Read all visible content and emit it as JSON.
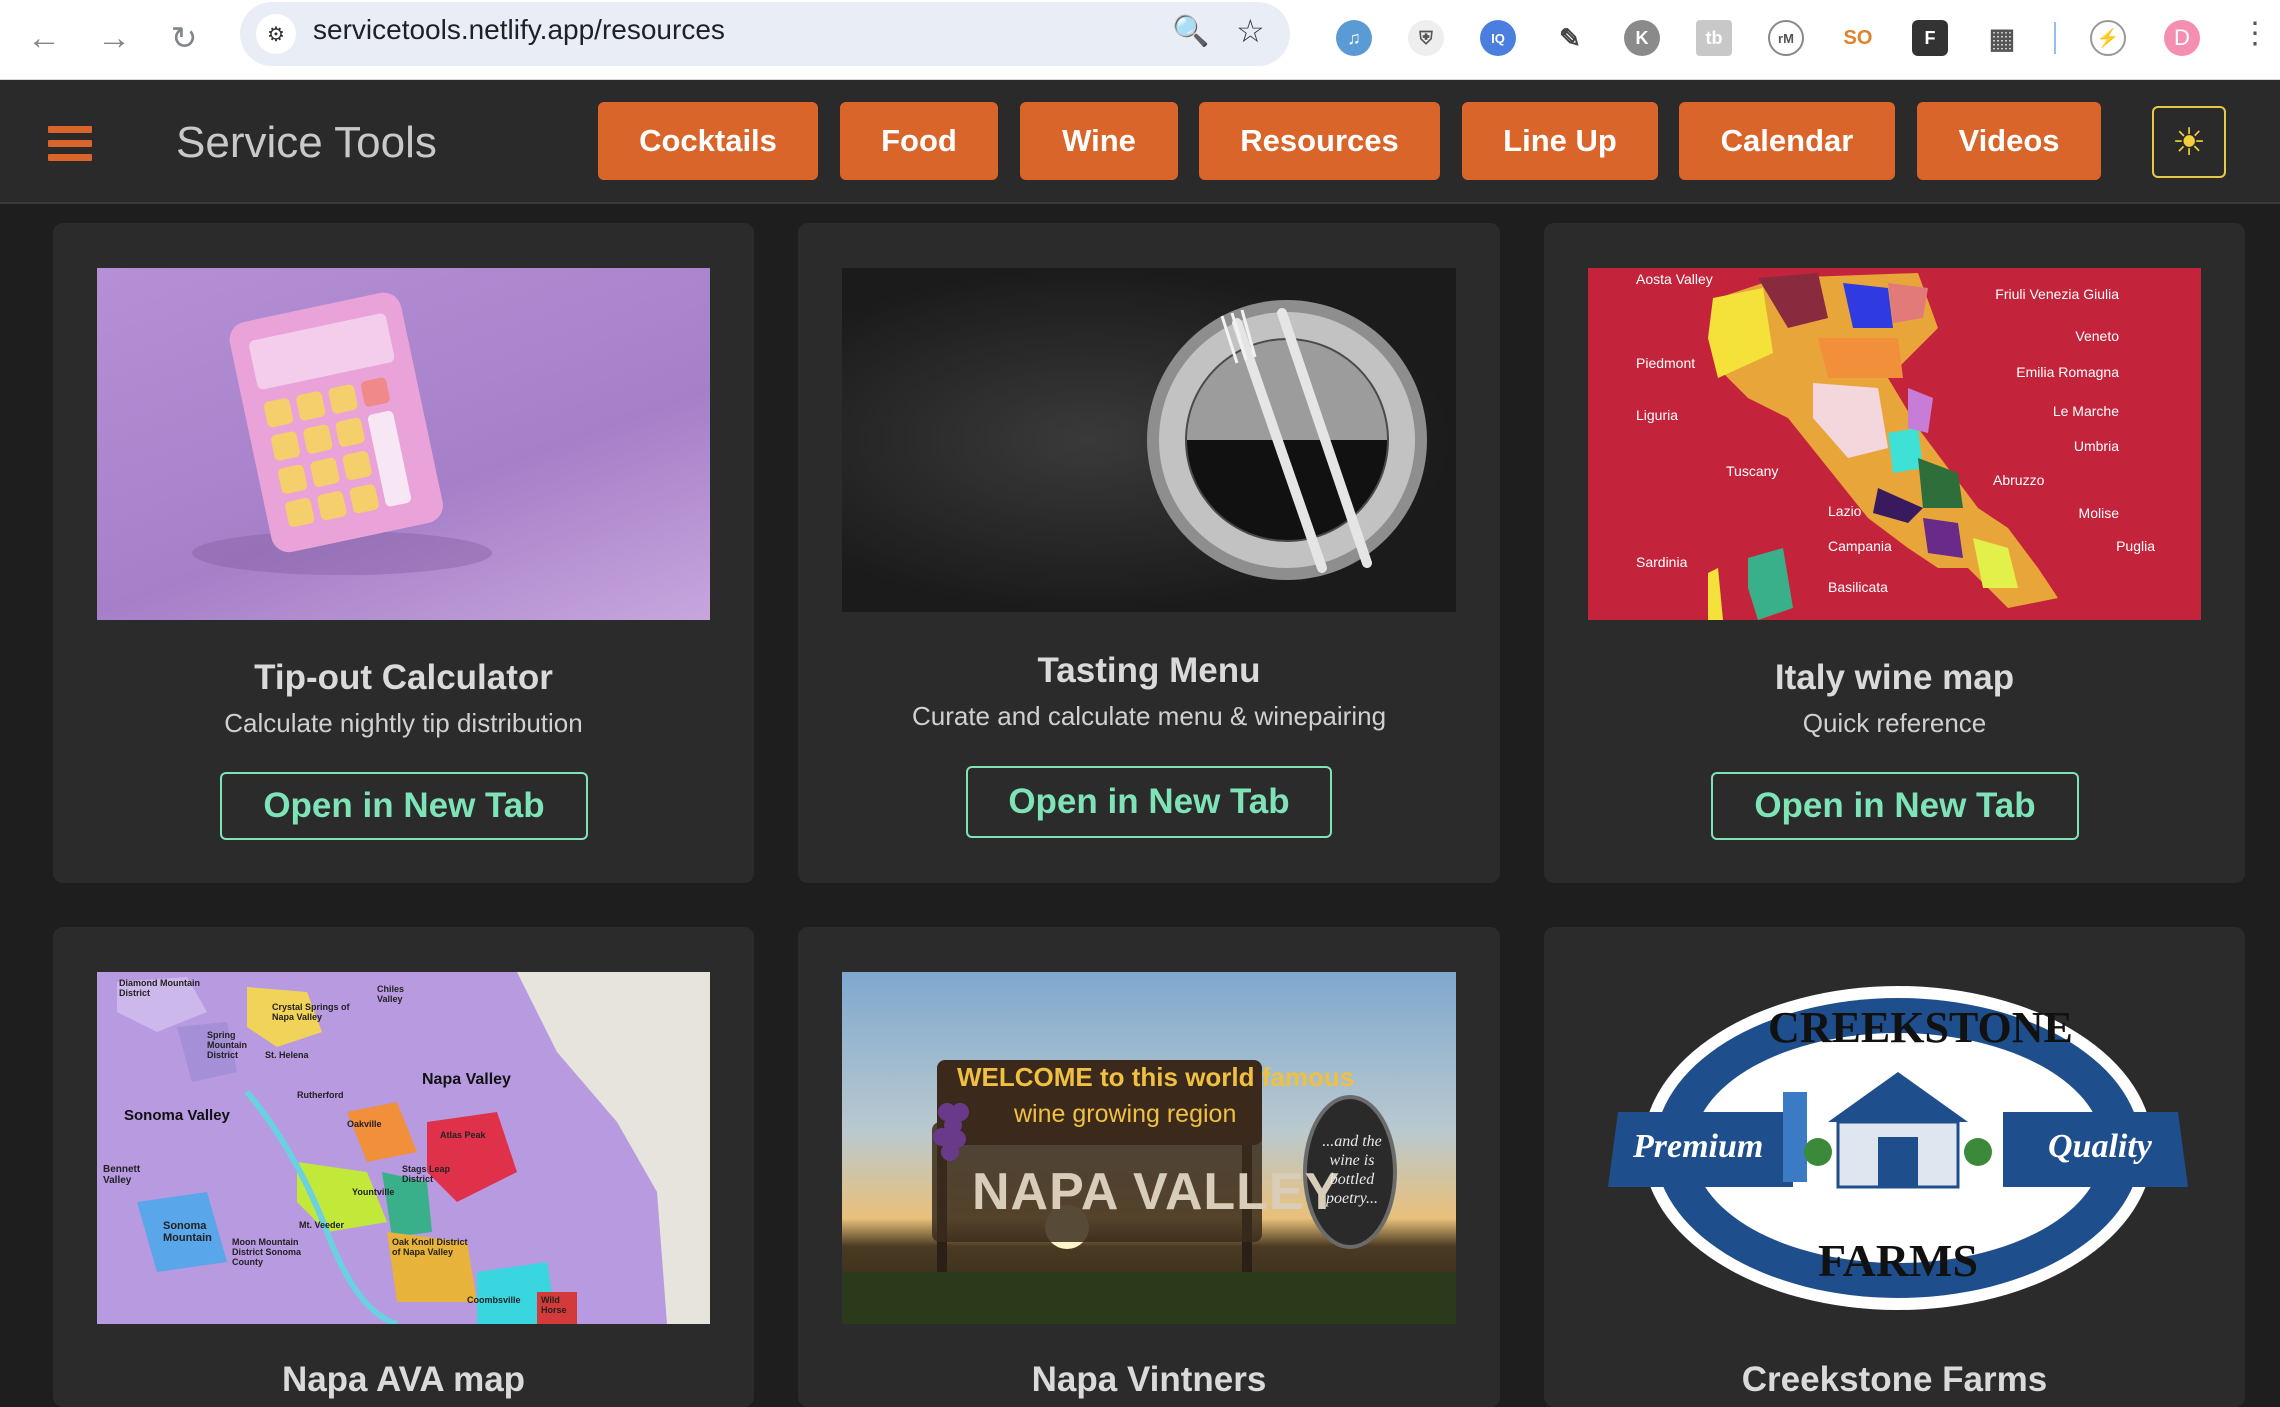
{
  "browser": {
    "url": "servicetools.netlify.app/resources",
    "profile_initial": "D"
  },
  "app": {
    "brand": "Service Tools",
    "nav": [
      "Cocktails",
      "Food",
      "Wine",
      "Resources",
      "Line Up",
      "Calendar",
      "Videos"
    ],
    "accent": "#d9652b",
    "button_accent": "#7ee3b6"
  },
  "cards": [
    {
      "title": "Tip-out Calculator",
      "subtitle": "Calculate nightly tip distribution",
      "button": "Open in New Tab"
    },
    {
      "title": "Tasting Menu",
      "subtitle": "Curate and calculate menu & winepairing",
      "button": "Open in New Tab"
    },
    {
      "title": "Italy wine map",
      "subtitle": "Quick reference",
      "button": "Open in New Tab"
    },
    {
      "title": "Napa AVA map"
    },
    {
      "title": "Napa Vintners"
    },
    {
      "title": "Creekstone Farms"
    }
  ],
  "italy_map_labels": [
    "Aosta Valley",
    "Friuli Venezia Giulia",
    "Veneto",
    "Piedmont",
    "Emilia Romagna",
    "Liguria",
    "Le Marche",
    "Umbria",
    "Tuscany",
    "Abruzzo",
    "Lazio",
    "Molise",
    "Campania",
    "Puglia",
    "Sardinia",
    "Basilicata"
  ],
  "napa_map_labels": [
    "Diamond Mountain District",
    "Chiles Valley",
    "Crystal Springs of Napa Valley",
    "Spring Mountain District",
    "St. Helena",
    "Napa Valley",
    "Sonoma Valley",
    "Rutherford",
    "Oakville",
    "Atlas Peak",
    "Bennett Valley",
    "Stags Leap District",
    "Yountville",
    "Sonoma Mountain",
    "Mt. Veeder",
    "Moon Mountain District Sonoma County",
    "Oak Knoll District of Napa Valley",
    "Coombsville",
    "Wild Horse"
  ],
  "napa_sign": {
    "line1": "WELCOME to this world famous",
    "line2": "wine growing region",
    "main": "NAPA VALLEY",
    "side": "...and the wine is bottled poetry..."
  },
  "creekstone": {
    "arc_top": "CREEKSTONE",
    "left": "Premium",
    "right": "Quality",
    "arc_bottom": "FARMS"
  }
}
